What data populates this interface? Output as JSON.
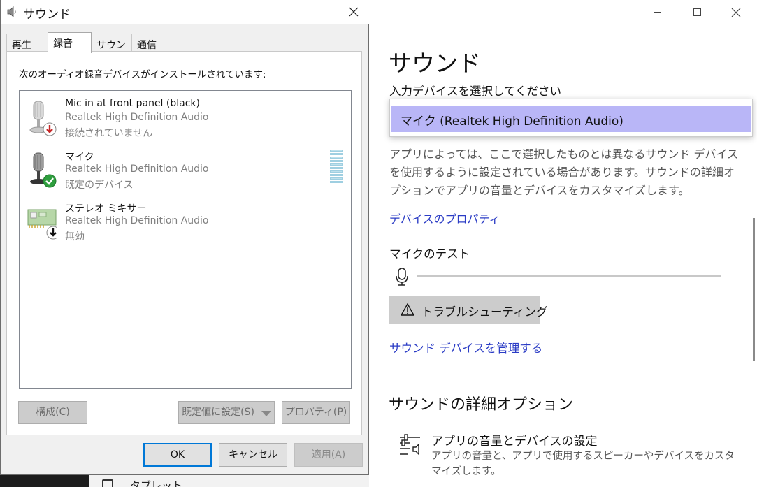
{
  "settings": {
    "title": "サウンド",
    "input_label": "入力デバイスを選択してください",
    "dropdown_selected": "マイク (Realtek High Definition Audio)",
    "description": "アプリによっては、ここで選択したものとは異なるサウンド デバイスを使用するように設定されている場合があります。サウンドの詳細オプションでアプリの音量とデバイスをカスタマイズします。",
    "device_properties_link": "デバイスのプロパティ",
    "mic_test_label": "マイクのテスト",
    "mic_level": 0,
    "troubleshoot_label": "トラブルシューティング",
    "manage_devices_link": "サウンド デバイスを管理する",
    "advanced_title": "サウンドの詳細オプション",
    "advanced_item_title": "アプリの音量とデバイスの設定",
    "advanced_item_desc": "アプリの音量と、アプリで使用するスピーカーやデバイスをカスタマイズします。",
    "accent_color": "#2b3cc5",
    "highlight_color": "#b9b6f7"
  },
  "dialog": {
    "title": "サウンド",
    "tabs": [
      {
        "label": "再生"
      },
      {
        "label": "録音"
      },
      {
        "label": "サウンド"
      },
      {
        "label": "通信"
      }
    ],
    "active_tab": "録音",
    "instruction": "次のオーディオ録音デバイスがインストールされています:",
    "devices": [
      {
        "name": "Mic in at front panel (black)",
        "driver": "Realtek High Definition Audio",
        "status": "接続されていません",
        "icon": "microphone-disconnected-icon"
      },
      {
        "name": "マイク",
        "driver": "Realtek High Definition Audio",
        "status": "既定のデバイス",
        "icon": "microphone-default-icon"
      },
      {
        "name": "ステレオ ミキサー",
        "driver": "Realtek High Definition Audio",
        "status": "無効",
        "icon": "sound-card-disabled-icon"
      }
    ],
    "buttons": {
      "configure": "構成(C)",
      "set_default": "既定値に設定(S)",
      "properties": "プロパティ(P)",
      "ok": "OK",
      "cancel": "キャンセル",
      "apply": "適用(A)"
    }
  },
  "taskbar_peek": {
    "label": "タブレット"
  }
}
